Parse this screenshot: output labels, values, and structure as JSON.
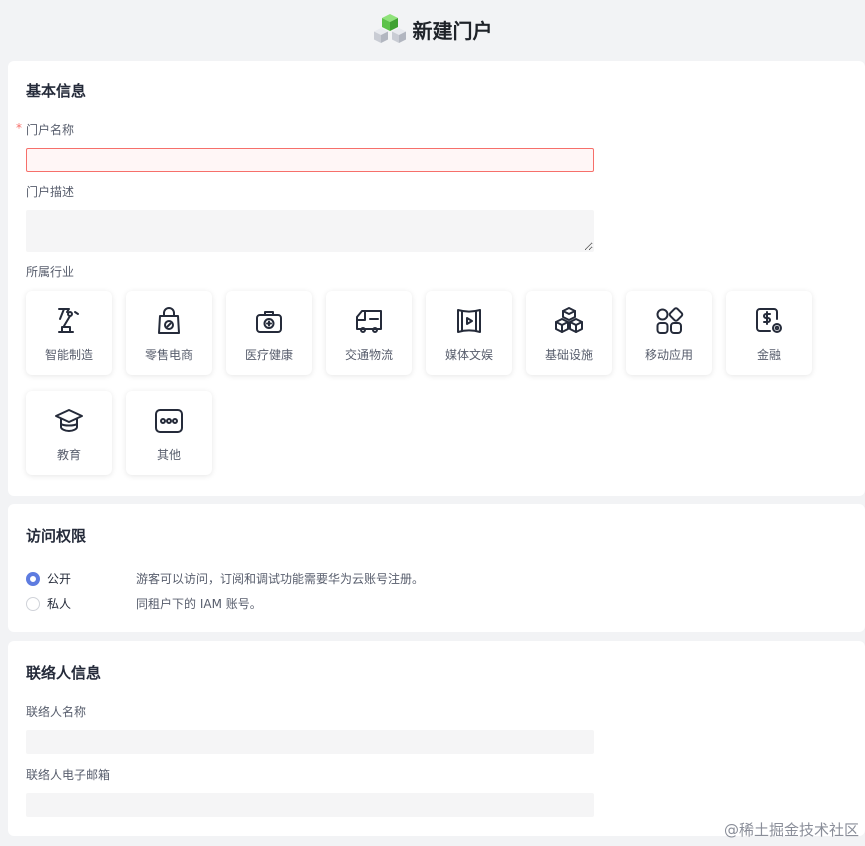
{
  "header": {
    "title": "新建门户",
    "logo_icon": "cube-stack-icon"
  },
  "basic": {
    "section_title": "基本信息",
    "name_required_mark": "*",
    "name_label": "门户名称",
    "name_value": "",
    "desc_label": "门户描述",
    "desc_value": "",
    "industry_label": "所属行业",
    "industries": [
      {
        "label": "智能制造",
        "icon": "robot-arm-icon"
      },
      {
        "label": "零售电商",
        "icon": "shopping-bag-icon"
      },
      {
        "label": "医疗健康",
        "icon": "medical-kit-icon"
      },
      {
        "label": "交通物流",
        "icon": "truck-icon"
      },
      {
        "label": "媒体文娱",
        "icon": "media-play-icon"
      },
      {
        "label": "基础设施",
        "icon": "cubes-icon"
      },
      {
        "label": "移动应用",
        "icon": "app-grid-icon"
      },
      {
        "label": "金融",
        "icon": "finance-icon"
      },
      {
        "label": "教育",
        "icon": "graduation-cap-icon"
      },
      {
        "label": "其他",
        "icon": "more-dots-icon"
      }
    ]
  },
  "access": {
    "section_title": "访问权限",
    "options": [
      {
        "label": "公开",
        "desc": "游客可以访问，订阅和调试功能需要华为云账号注册。",
        "checked": true
      },
      {
        "label": "私人",
        "desc": "同租户下的 IAM 账号。",
        "checked": false
      }
    ],
    "accent_color": "#5e7ce0"
  },
  "contact": {
    "section_title": "联络人信息",
    "name_label": "联络人名称",
    "name_value": "",
    "email_label": "联络人电子邮箱",
    "email_value": ""
  },
  "watermark": "@稀土掘金技术社区",
  "colors": {
    "error": "#f66f6a",
    "background": "#f2f3f5"
  }
}
